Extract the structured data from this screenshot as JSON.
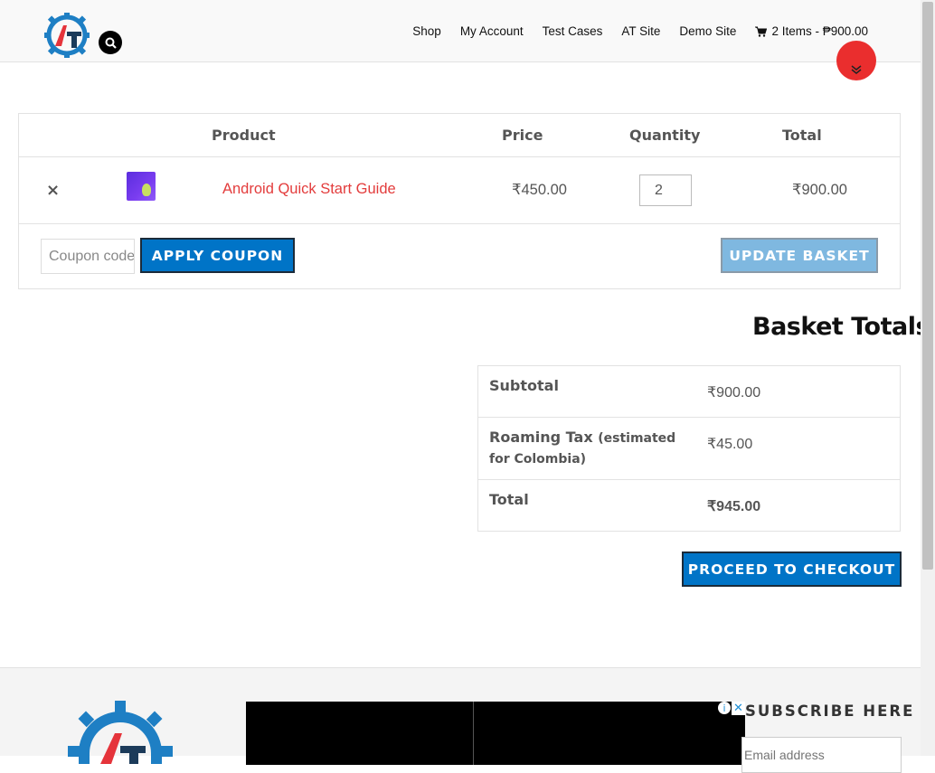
{
  "header": {
    "nav": [
      "Shop",
      "My Account",
      "Test Cases",
      "AT Site",
      "Demo Site"
    ],
    "cart_label": "2 Items - ₱900.00"
  },
  "cart": {
    "columns": {
      "product": "Product",
      "price": "Price",
      "quantity": "Quantity",
      "total": "Total"
    },
    "items": [
      {
        "remove": "×",
        "name": "Android Quick Start Guide",
        "price": "₹450.00",
        "quantity": "2",
        "total": "₹900.00"
      }
    ],
    "coupon_placeholder": "Coupon code",
    "apply_label": "APPLY COUPON",
    "update_label": "UPDATE BASKET"
  },
  "totals": {
    "title": "Basket Totals",
    "subtotal_label": "Subtotal",
    "subtotal_value": "₹900.00",
    "tax_label": "Roaming Tax",
    "tax_note_1": "(estimated",
    "tax_note_2": "for Colombia)",
    "tax_value": "₹45.00",
    "total_label": "Total",
    "total_value": "₹945.00",
    "checkout_label": "PROCEED TO CHECKOUT"
  },
  "footer": {
    "subscribe_heading": "SUBSCRIBE HERE",
    "email_placeholder": "Email address"
  },
  "icons": {
    "search": "search-icon",
    "cart": "cart-icon",
    "scroll_down": "chevron-double-down-icon",
    "remove": "close-icon"
  },
  "colors": {
    "accent_blue": "#0074c7",
    "product_link_red": "#e33c3c",
    "fab_red": "#ea2e2e"
  }
}
